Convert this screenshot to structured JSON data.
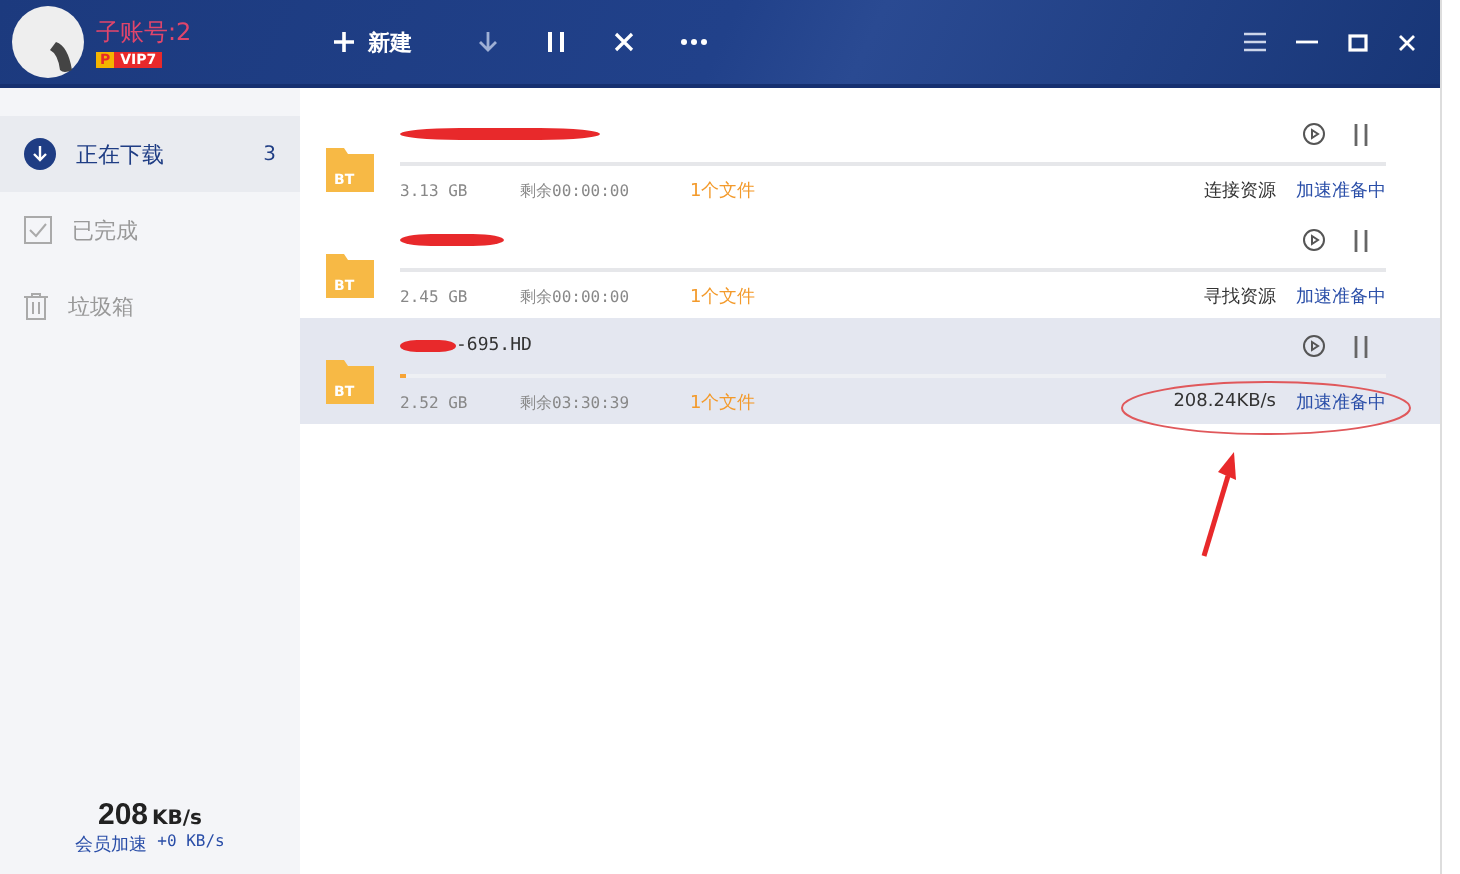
{
  "account": {
    "name": "子账号:2",
    "vip_mark": "P",
    "vip_level": "VIP7"
  },
  "toolbar": {
    "new_label": "新建"
  },
  "sidebar": {
    "items": [
      {
        "kind": "downloading",
        "label": "正在下载",
        "count": "3",
        "selected": true
      },
      {
        "kind": "done",
        "label": "已完成",
        "selected": false
      },
      {
        "kind": "trash",
        "label": "垃圾箱",
        "selected": false
      }
    ]
  },
  "downloads": [
    {
      "file_type": "BT",
      "name_redacted": true,
      "size": "3.13 GB",
      "remaining": "剩余00:00:00",
      "files": "1个文件",
      "status": "连接资源",
      "accel": "加速准备中",
      "level": 0,
      "selected": false
    },
    {
      "file_type": "BT",
      "name_redacted": true,
      "size": "2.45 GB",
      "remaining": "剩余00:00:00",
      "files": "1个文件",
      "status": "寻找资源",
      "accel": "加速准备中",
      "level": 0,
      "selected": false
    },
    {
      "file_type": "BT",
      "name_redacted": true,
      "name": "-695.HD",
      "size": "2.52 GB",
      "remaining": "剩余03:30:39",
      "files": "1个文件",
      "status": "208.24KB/s",
      "accel": "加速准备中",
      "level": 0.006,
      "selected": true,
      "annotated": true
    }
  ],
  "speed": {
    "value": "208",
    "unit": "KB/s",
    "vip_label": "会员加速",
    "vip_speed": "+0 KB/s"
  }
}
